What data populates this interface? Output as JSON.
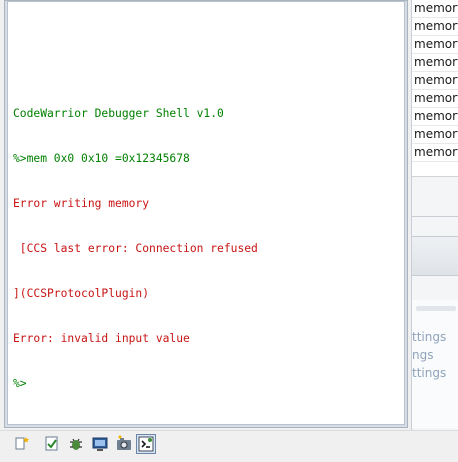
{
  "shell": {
    "lines": [
      {
        "text": "CodeWarrior Debugger Shell v1.0",
        "kind": "ok"
      },
      {
        "text": "%>mem 0x0 0x10 =0x12345678",
        "kind": "ok"
      },
      {
        "text": "Error writing memory",
        "kind": "err"
      },
      {
        "text": " [CCS last error: Connection refused",
        "kind": "err"
      },
      {
        "text": "](CCSProtocolPlugin)",
        "kind": "err"
      },
      {
        "text": "Error: invalid input value",
        "kind": "err"
      },
      {
        "text": "%>",
        "kind": "ok"
      }
    ]
  },
  "right_panel": {
    "memory_rows": [
      "memory",
      "memory",
      "memory",
      "memory",
      "memory",
      "memory",
      "memory",
      "memory",
      "memory",
      "memory"
    ],
    "settings_items": [
      "ttings",
      "ngs",
      "ttings"
    ]
  },
  "toolbar": {
    "buttons": [
      {
        "icon": "new-view-icon",
        "active": false
      },
      {
        "icon": "check-icon",
        "active": false
      },
      {
        "icon": "bug-icon",
        "active": false
      },
      {
        "icon": "monitor-icon",
        "active": false
      },
      {
        "icon": "camera-icon",
        "active": false
      },
      {
        "icon": "debugger-shell-icon",
        "active": true
      }
    ]
  },
  "colors": {
    "ok": "#008000",
    "err": "#c81414",
    "settings": "#8fa3bb"
  }
}
